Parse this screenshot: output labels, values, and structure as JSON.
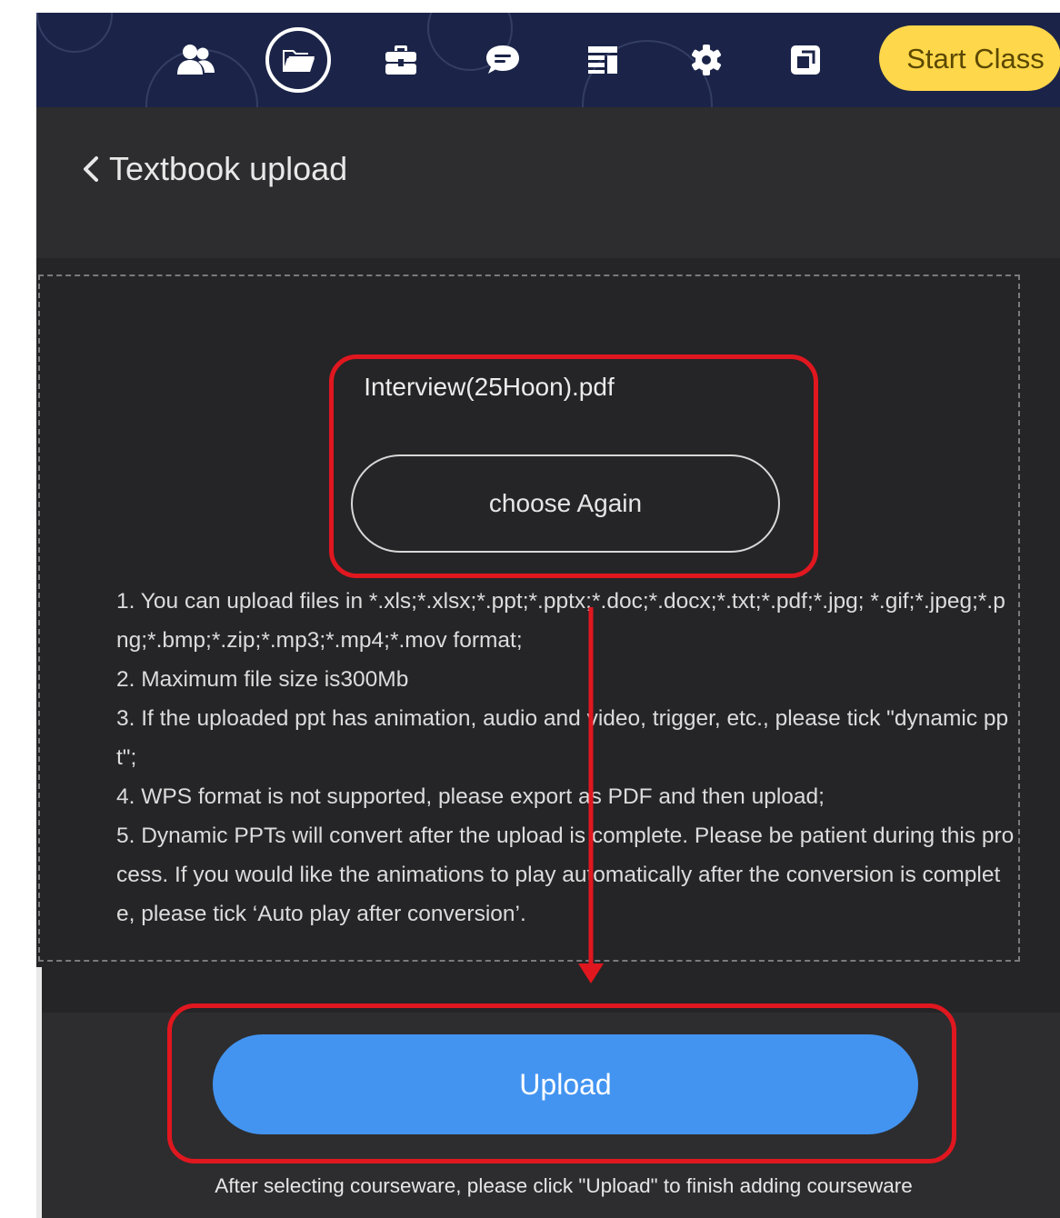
{
  "toolbar": {
    "icons": [
      {
        "name": "users-icon"
      },
      {
        "name": "folder-open-icon",
        "active": true
      },
      {
        "name": "toolbox-icon"
      },
      {
        "name": "chat-icon"
      },
      {
        "name": "layout-icon"
      },
      {
        "name": "settings-icon"
      },
      {
        "name": "window-icon"
      }
    ],
    "start_class_label": "Start Class"
  },
  "header": {
    "title": "Textbook upload"
  },
  "upload": {
    "file_name": "Interview(25Hoon).pdf",
    "choose_again_label": "choose Again",
    "instructions": [
      "1. You can upload files in *.xls;*.xlsx;*.ppt;*.pptx;*.doc;*.docx;*.txt;*.pdf;*.jpg; *.gif;*.jpeg;*.png;*.bmp;*.zip;*.mp3;*.mp4;*.mov format;",
      "2. Maximum file size is300Mb",
      "3. If the uploaded ppt has animation, audio and video, trigger, etc., please tick \"dynamic ppt\";",
      "4. WPS format is not supported, please export as PDF and then upload;",
      "5. Dynamic PPTs will convert after the upload is complete. Please be patient during this process. If you would like the animations to play automatically after the conversion is complete, please tick ‘Auto play after conversion’."
    ],
    "upload_label": "Upload",
    "footer_note": "After selecting courseware, please click \"Upload\" to finish adding courseware"
  },
  "colors": {
    "app_bg": "#2d2d2f",
    "topbar_bg": "#1b2448",
    "start_class_bg": "#ffd74a",
    "upload_bg": "#4394f1",
    "annotation_red": "#e0171f"
  }
}
